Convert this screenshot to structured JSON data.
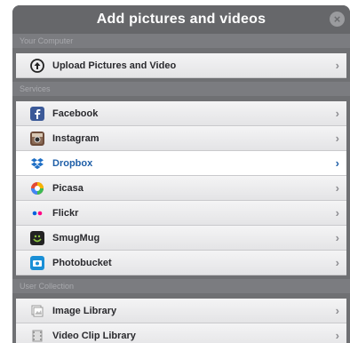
{
  "dialog": {
    "title": "Add pictures and videos",
    "close_icon": "close-icon"
  },
  "sections": {
    "computer": {
      "header": "Your Computer",
      "items": [
        {
          "label": "Upload Pictures and Video",
          "icon": "upload-icon"
        }
      ]
    },
    "services": {
      "header": "Services",
      "items": [
        {
          "label": "Facebook",
          "icon": "facebook-icon"
        },
        {
          "label": "Instagram",
          "icon": "instagram-icon"
        },
        {
          "label": "Dropbox",
          "icon": "dropbox-icon",
          "selected": true
        },
        {
          "label": "Picasa",
          "icon": "picasa-icon"
        },
        {
          "label": "Flickr",
          "icon": "flickr-icon"
        },
        {
          "label": "SmugMug",
          "icon": "smugmug-icon"
        },
        {
          "label": "Photobucket",
          "icon": "photobucket-icon"
        }
      ]
    },
    "collection": {
      "header": "User Collection",
      "items": [
        {
          "label": "Image Library",
          "icon": "image-library-icon"
        },
        {
          "label": "Video Clip Library",
          "icon": "video-library-icon"
        }
      ]
    }
  },
  "chevron": "›"
}
